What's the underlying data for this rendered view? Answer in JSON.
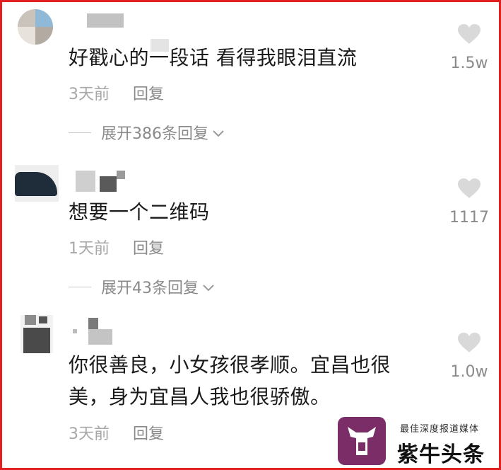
{
  "comments": [
    {
      "text": "好戳心的一段话  看得我眼泪直流",
      "time": "3天前",
      "reply_label": "回复",
      "expand_label": "展开386条回复",
      "like_count": "1.5w"
    },
    {
      "text": "想要一个二维码",
      "time": "1天前",
      "reply_label": "回复",
      "expand_label": "展开43条回复",
      "like_count": "1117"
    },
    {
      "text": "你很善良，小女孩很孝顺。宜昌也很美，身为宜昌人我也很骄傲。",
      "time": "3天前",
      "reply_label": "回复",
      "like_count": "1.0w"
    }
  ],
  "watermark": {
    "tagline": "最佳深度报道媒体",
    "brand_name": "紫牛头条"
  },
  "colors": {
    "frame_border": "#e32020",
    "brand_purple": "#7a2d67",
    "muted_text": "#a7a7a7",
    "heart": "#d9d9d9"
  }
}
